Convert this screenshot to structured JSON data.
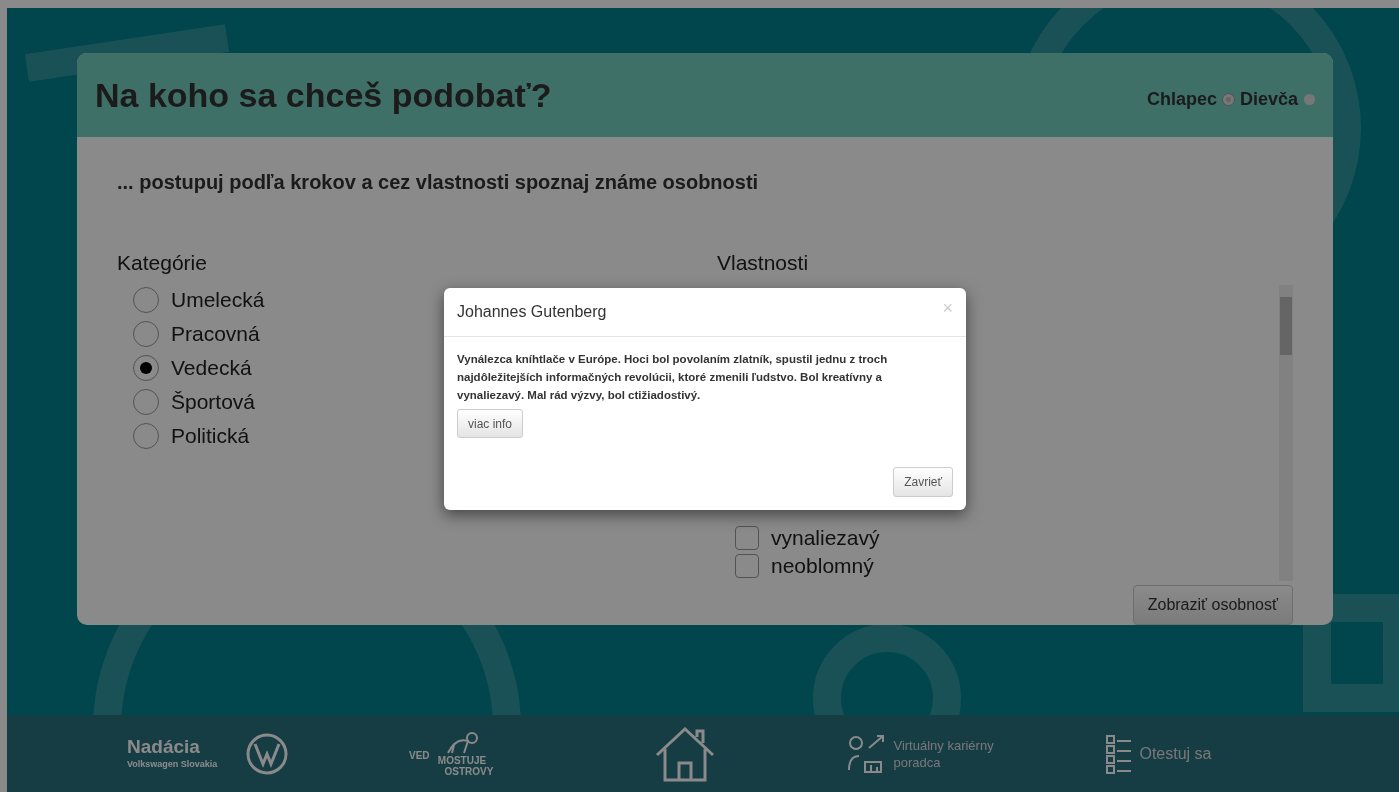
{
  "header": {
    "title": "Na koho sa chceš podobať?",
    "gender": [
      {
        "label": "Chlapec",
        "selected": true
      },
      {
        "label": "Dievča",
        "selected": false
      }
    ]
  },
  "subtitle": "... postupuj podľa krokov a cez vlastnosti spoznaj známe osobnosti",
  "categories": {
    "heading": "Kategórie",
    "options": [
      {
        "label": "Umelecká",
        "selected": false
      },
      {
        "label": "Pracovná",
        "selected": false
      },
      {
        "label": "Vedecká",
        "selected": true
      },
      {
        "label": "Športová",
        "selected": false
      },
      {
        "label": "Politická",
        "selected": false
      }
    ]
  },
  "traits": {
    "heading": "Vlastnosti",
    "items": [
      {
        "label": "vynaliezavý",
        "checked": false
      },
      {
        "label": "neoblomný",
        "checked": false
      }
    ]
  },
  "show_button": "Zobraziť osobnosť",
  "modal": {
    "title": "Johannes Gutenberg",
    "close": "×",
    "text": "Vynálezca kníhtlače v Európe. Hoci bol povolaním zlatník, spustil jednu z troch najdôležitejších informačných revolúcii, ktoré zmenili ľudstvo. Bol kreatívny a vynaliezavý. Mal rád výzvy, bol ctižiadostivý.",
    "more": "viac info",
    "dismiss": "Zavrieť"
  },
  "footer": {
    "foundation": "Nadácia",
    "foundation_sub": "Volkswagen Slovakia",
    "science_logo": [
      "VED",
      "MOSTUJE",
      "OSTROVY"
    ],
    "advisor": "Virtuálny kariérny poradca",
    "test": "Otestuj sa"
  }
}
